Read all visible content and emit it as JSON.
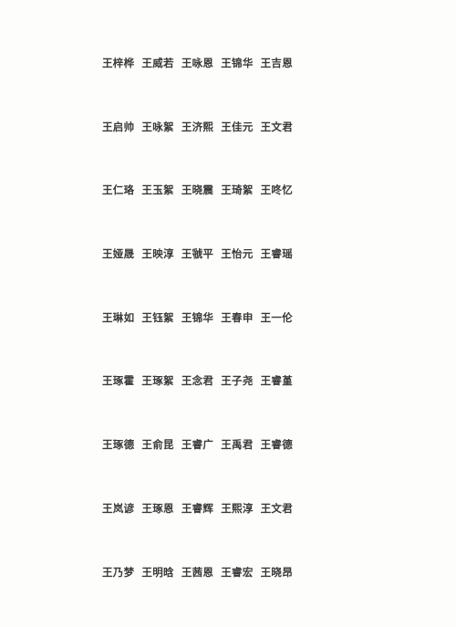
{
  "page": {
    "background_color": "#fdfdfb",
    "text_color": "#3a3a3a",
    "surname": "王",
    "column_count": 5,
    "row_count": 9
  },
  "name_grid": {
    "rows": [
      {
        "names": [
          "王梓桦",
          "王威若",
          "王咏恩",
          "王锦华",
          "王吉恩"
        ]
      },
      {
        "names": [
          "王启帅",
          "王咏絮",
          "王济熙",
          "王佳元",
          "王文君"
        ]
      },
      {
        "names": [
          "王仁珞",
          "王玉絮",
          "王晓震",
          "王琦絮",
          "王咚忆"
        ]
      },
      {
        "names": [
          "王娅晟",
          "王映淳",
          "王虢平",
          "王怡元",
          "王睿瑶"
        ]
      },
      {
        "names": [
          "王琳如",
          "王钰絮",
          "王锦华",
          "王春申",
          "王一伦"
        ]
      },
      {
        "names": [
          "王琢霍",
          "王琢絮",
          "王念君",
          "王子尧",
          "王睿堇"
        ]
      },
      {
        "names": [
          "王琢德",
          "王俞昆",
          "王睿广",
          "王禹君",
          "王睿德"
        ]
      },
      {
        "names": [
          "王岚谚",
          "王琢恩",
          "王睿辉",
          "王熙淳",
          "王文君"
        ]
      },
      {
        "names": [
          "王乃梦",
          "王明晗",
          "王茜恩",
          "王睿宏",
          "王晓昂"
        ]
      }
    ]
  }
}
